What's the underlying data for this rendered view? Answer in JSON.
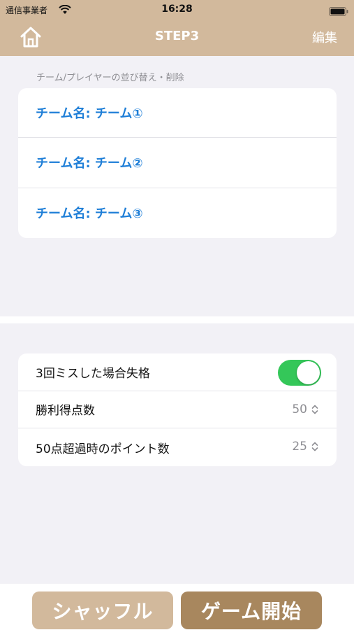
{
  "status_bar": {
    "carrier": "通信事業者",
    "time": "16:28"
  },
  "nav": {
    "title": "STEP3",
    "edit_label": "編集"
  },
  "teams_section": {
    "header": "チーム/プレイヤーの並び替え・削除",
    "teams": [
      {
        "label": "チーム名: チーム①"
      },
      {
        "label": "チーム名: チーム②"
      },
      {
        "label": "チーム名: チーム③"
      }
    ]
  },
  "settings": {
    "disqualify_label": "3回ミスした場合失格",
    "disqualify_on": true,
    "winning_score_label": "勝利得点数",
    "winning_score_value": "50",
    "over50_label": "50点超過時のポイント数",
    "over50_value": "25"
  },
  "buttons": {
    "shuffle": "シャッフル",
    "start": "ゲーム開始"
  },
  "colors": {
    "header_bg": "#d2b99c",
    "team_text": "#1e7ed7",
    "toggle_on": "#34c759",
    "start_bg": "#a8875e"
  }
}
